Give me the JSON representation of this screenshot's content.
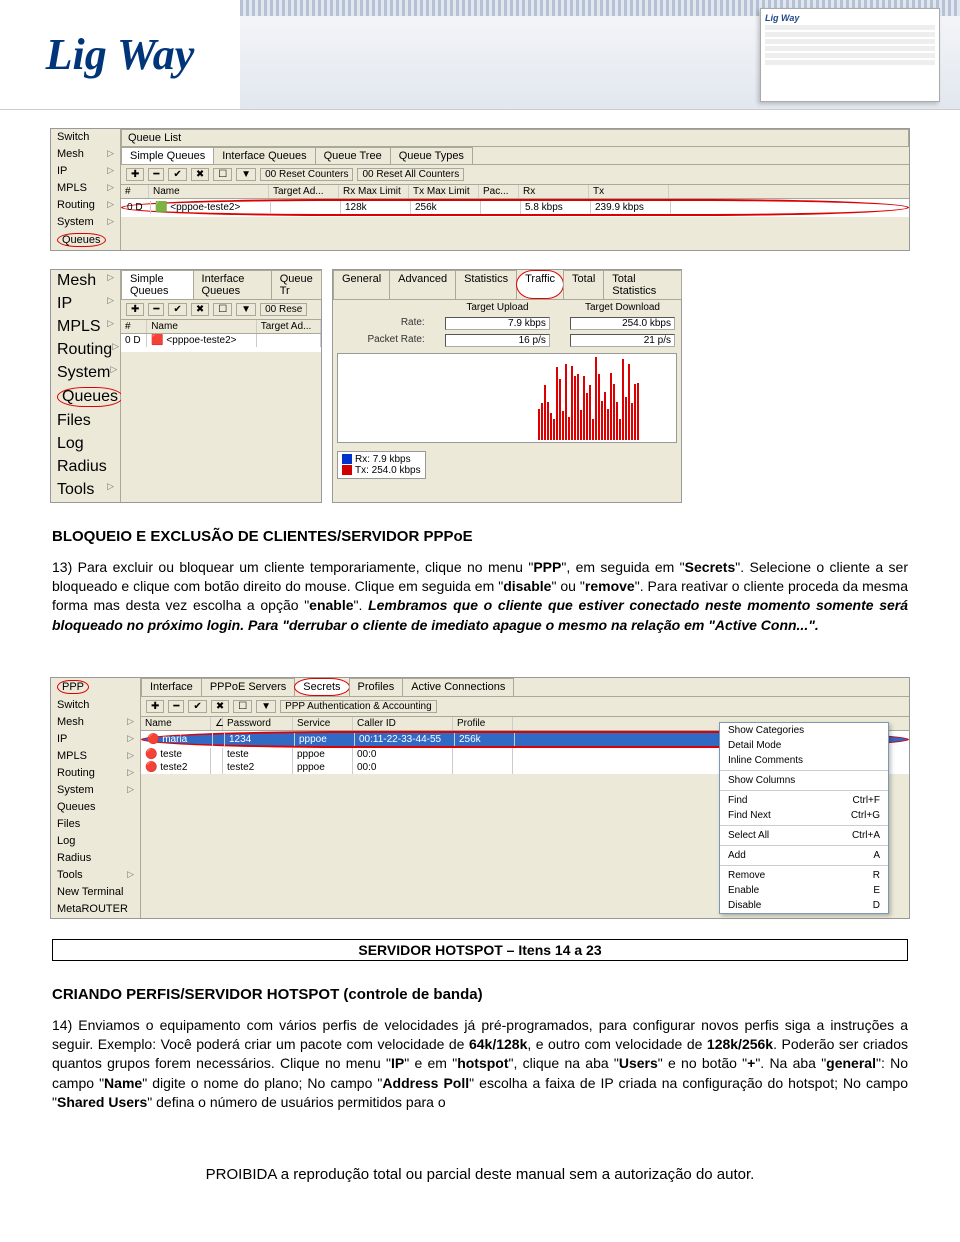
{
  "banner": {
    "logo_text": "Lig Way",
    "mini_logo": "Lig Way"
  },
  "shot1": {
    "side_menu": [
      "Switch",
      "Mesh",
      "IP",
      "MPLS",
      "Routing",
      "System",
      "Queues"
    ],
    "side_menu_circled_index": 6,
    "title": "Queue List",
    "tabs": [
      "Simple Queues",
      "Interface Queues",
      "Queue Tree",
      "Queue Types"
    ],
    "toolbar": {
      "buttons": [
        "✚",
        "━",
        "✔",
        "✖",
        "☐",
        "▼"
      ],
      "reset": "00 Reset Counters",
      "reset_all": "00 Reset All Counters"
    },
    "columns": [
      "#",
      "Name",
      "Target Ad...",
      "Rx Max Limit",
      "Tx Max Limit",
      "Pac...",
      "Rx",
      "Tx"
    ],
    "row": [
      "0 D",
      "🟩 <pppoe-teste2>",
      "",
      "128k",
      "256k",
      "",
      "5.8 kbps",
      "239.9 kbps"
    ]
  },
  "shot2": {
    "side_menu": [
      "Mesh",
      "IP",
      "MPLS",
      "Routing",
      "System",
      "Queues",
      "Files",
      "Log",
      "Radius",
      "Tools"
    ],
    "side_menu_circled_index": 5,
    "left_tabs": [
      "Simple Queues",
      "Interface Queues",
      "Queue Tr"
    ],
    "left_toolbar_buttons": [
      "✚",
      "━",
      "✔",
      "✖",
      "☐",
      "▼"
    ],
    "left_toolbar_reset": "00 Rese",
    "left_columns": [
      "#",
      "Name",
      "Target Ad..."
    ],
    "left_row": [
      "0 D",
      "🟥 <pppoe-teste2>",
      ""
    ],
    "right_tabs": [
      "General",
      "Advanced",
      "Statistics",
      "Traffic",
      "Total",
      "Total Statistics"
    ],
    "right_tabs_circled_index": 3,
    "stats": {
      "upload_label": "Target Upload",
      "download_label": "Target Download",
      "rate_label": "Rate:",
      "rate_up": "7.9 kbps",
      "rate_down": "254.0 kbps",
      "packet_label": "Packet Rate:",
      "packet_up": "16 p/s",
      "packet_down": "21 p/s"
    },
    "legend": {
      "rx": "Rx: 7.9 kbps",
      "rx_color": "#0033cc",
      "tx": "Tx: 254.0 kbps",
      "tx_color": "#d00000"
    }
  },
  "text13": {
    "heading": "BLOQUEIO E EXCLUSÃO DE CLIENTES/SERVIDOR PPPoE",
    "body_parts": [
      "13) Para excluir ou bloquear um cliente temporariamente, clique no menu \"",
      "PPP",
      "\", em seguida em \"",
      "Secrets",
      "\". Selecione o cliente a ser bloqueado e clique com botão direito do mouse. Clique em seguida em \"",
      "disable",
      "\" ou \"",
      "remove",
      "\". Para reativar o cliente proceda da mesma forma mas desta vez escolha a opção \"",
      "enable",
      "\". "
    ],
    "italic_part": "Lembramos que o cliente que estiver conectado neste momento somente será bloqueado no próximo login. Para \"derrubar o cliente de imediato apague o mesmo na relação em \"Active Conn...\"."
  },
  "shot3": {
    "side_menu": [
      "PPP",
      "Switch",
      "Mesh",
      "IP",
      "MPLS",
      "Routing",
      "System",
      "Queues",
      "Files",
      "Log",
      "Radius",
      "Tools",
      "New Terminal",
      "MetaROUTER"
    ],
    "side_menu_circled_index": 0,
    "tabs": [
      "Interface",
      "PPPoE Servers",
      "Secrets",
      "Profiles",
      "Active Connections"
    ],
    "tabs_circled_index": 2,
    "ppp_auth_btn": "PPP Authentication & Accounting",
    "toolbar_buttons": [
      "✚",
      "━",
      "✔",
      "✖",
      "☐",
      "▼"
    ],
    "columns": [
      "Name",
      "∠",
      "Password",
      "Service",
      "Caller ID",
      "Profile"
    ],
    "rows": [
      [
        "🔴 maria",
        "",
        "1234",
        "pppoe",
        "00:11-22-33-44-55",
        "256k"
      ],
      [
        "🔴 teste",
        "",
        "teste",
        "pppoe",
        "00:0",
        ""
      ],
      [
        "🔴 teste2",
        "",
        "teste2",
        "pppoe",
        "00:0",
        ""
      ]
    ],
    "highlighted_row_index": 0,
    "ctx_menu": [
      {
        "label": "Show Categories",
        "key": ""
      },
      {
        "label": "Detail Mode",
        "key": ""
      },
      {
        "label": "Inline Comments",
        "key": ""
      },
      {
        "hr": true
      },
      {
        "label": "Show Columns",
        "key": ""
      },
      {
        "hr": true
      },
      {
        "label": "Find",
        "key": "Ctrl+F"
      },
      {
        "label": "Find Next",
        "key": "Ctrl+G"
      },
      {
        "hr": true
      },
      {
        "label": "Select All",
        "key": "Ctrl+A"
      },
      {
        "hr": true
      },
      {
        "label": "Add",
        "key": "A"
      },
      {
        "hr": true
      },
      {
        "label": "Remove",
        "key": "R"
      },
      {
        "label": "Enable",
        "key": "E"
      },
      {
        "label": "Disable",
        "key": "D"
      }
    ]
  },
  "section_box": "SERVIDOR HOTSPOT – Itens 14 a 23",
  "text14": {
    "heading": "CRIANDO PERFIS/SERVIDOR HOTSPOT (controle de banda)",
    "body_parts": [
      "14) Enviamos o equipamento com vários perfis de velocidades já pré-programados, para configurar novos perfis siga a instruções a seguir. Exemplo: Você poderá criar um pacote com velocidade de ",
      "64k/128k",
      ", e outro com velocidade de ",
      "128k/256k",
      ". Poderão ser criados quantos grupos forem necessários. Clique no menu \"",
      "IP",
      "\" e em \"",
      "hotspot",
      "\", clique na aba \"",
      "Users",
      "\" e no botão \"",
      "+",
      "\". Na aba \"",
      "general",
      "\": No campo \"",
      "Name",
      "\" digite o nome do plano; No campo \"",
      "Address Poll",
      "\" escolha a faixa de IP criada na configuração do hotspot; No campo \"",
      "Shared Users",
      "\" defina o número de usuários permitidos para o"
    ]
  },
  "footer": "PROIBIDA a reprodução total ou parcial deste manual sem a autorização do autor."
}
